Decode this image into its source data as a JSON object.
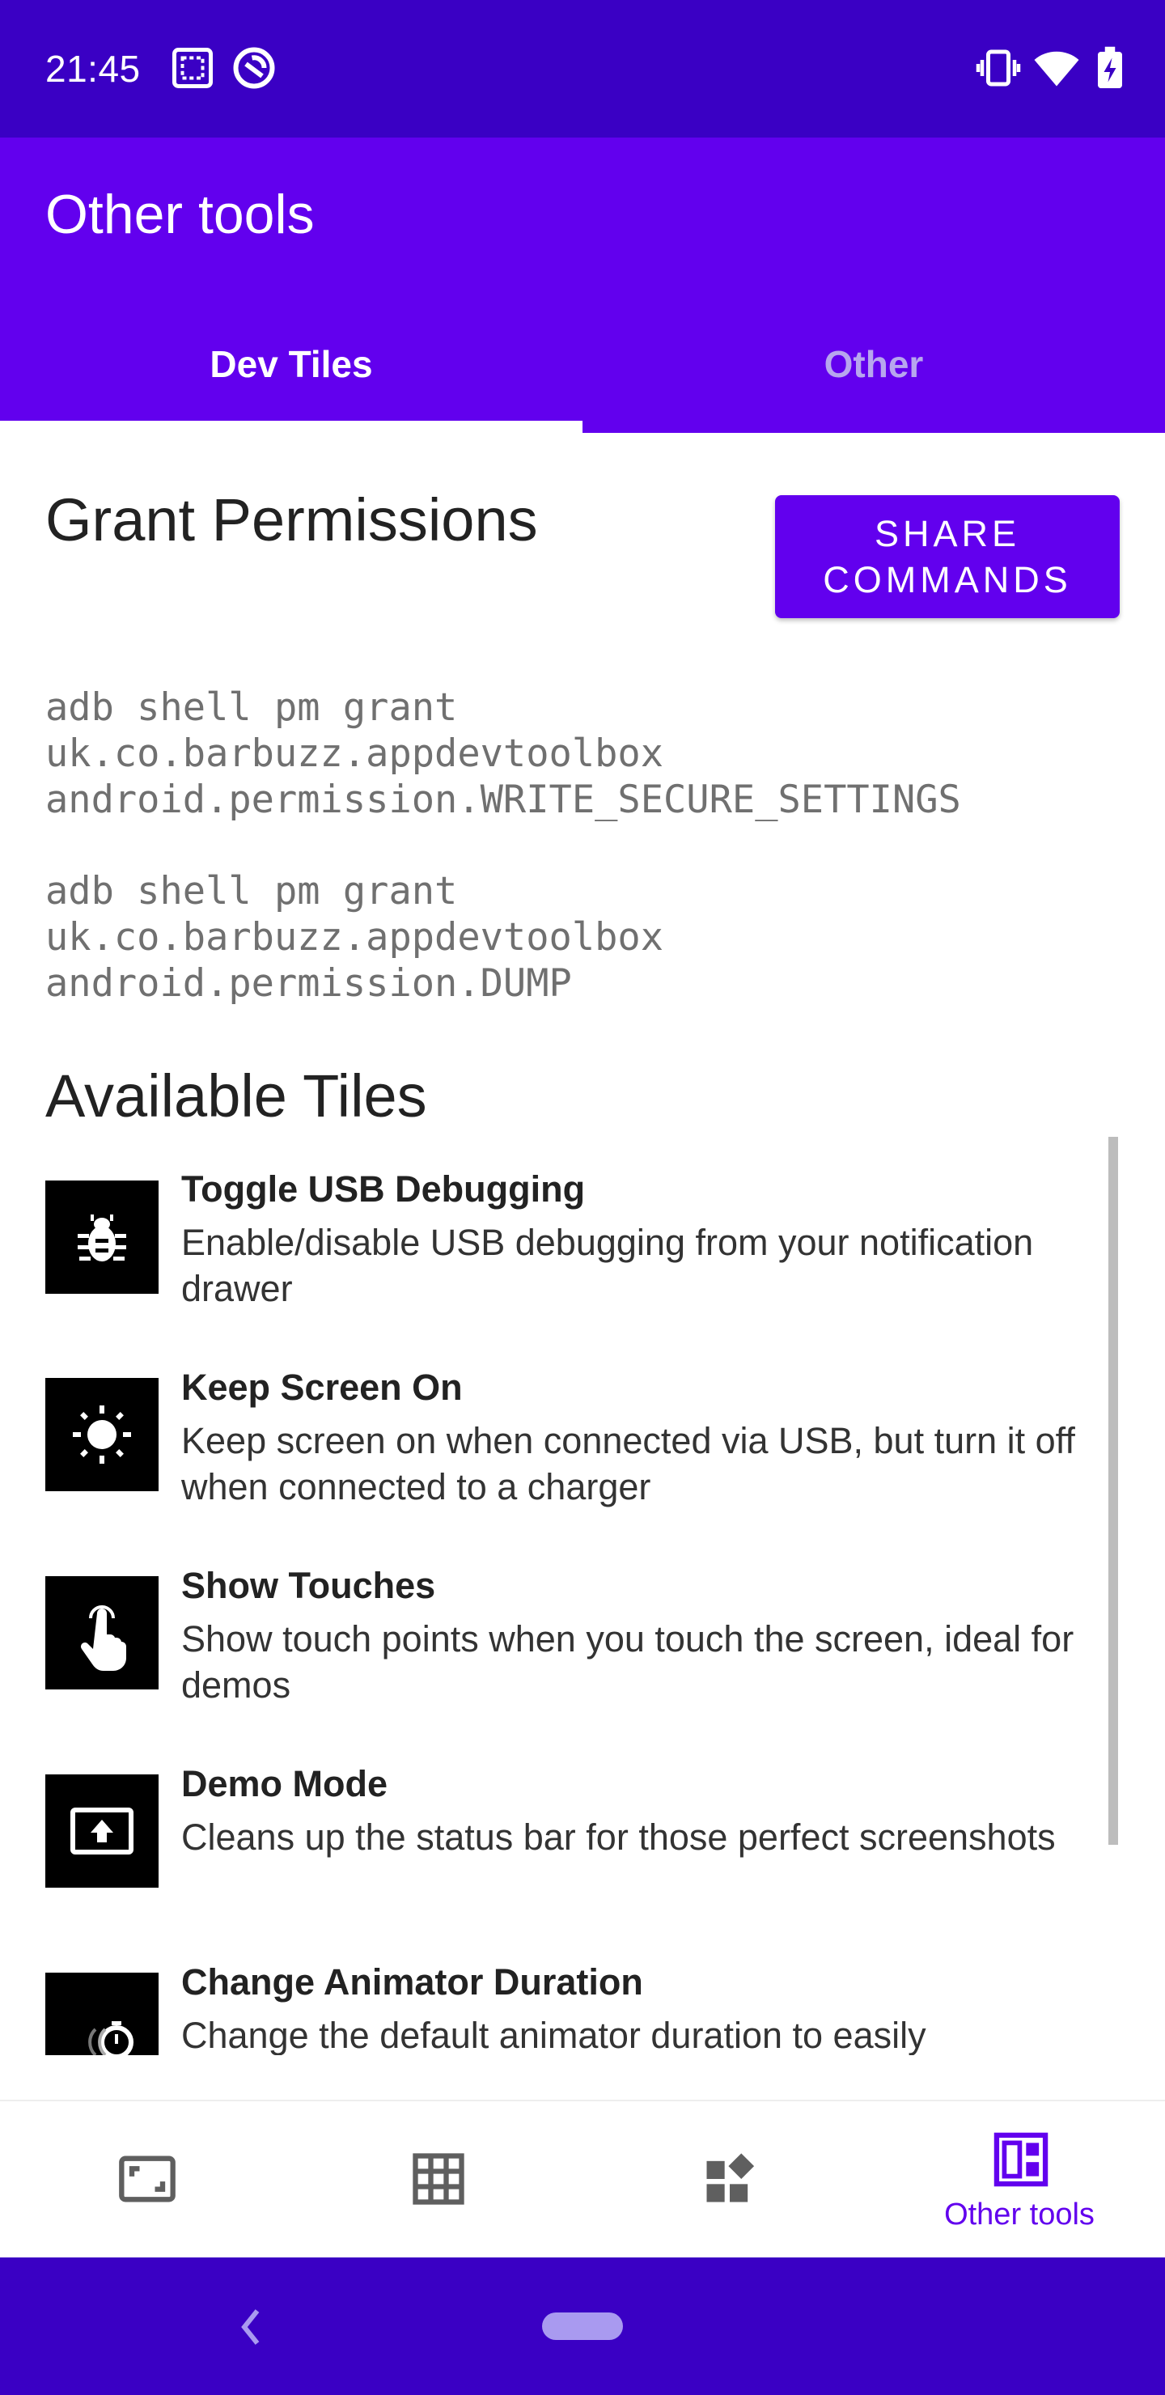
{
  "status_bar": {
    "time": "21:45",
    "icons": [
      "screenshot-icon",
      "data-saver-icon",
      "vibrate-icon",
      "wifi-icon",
      "battery-charging-icon"
    ]
  },
  "app_bar": {
    "title": "Other tools"
  },
  "tabs": [
    {
      "label": "Dev Tiles",
      "selected": true
    },
    {
      "label": "Other",
      "selected": false
    }
  ],
  "grant": {
    "title": "Grant Permissions",
    "share_label": "SHARE COMMANDS",
    "commands": [
      "adb shell pm grant\nuk.co.barbuzz.appdevtoolbox\nandroid.permission.WRITE_SECURE_SETTINGS",
      "adb shell pm grant\nuk.co.barbuzz.appdevtoolbox\nandroid.permission.DUMP"
    ]
  },
  "tiles": {
    "heading": "Available Tiles",
    "items": [
      {
        "title": "Toggle USB Debugging",
        "description": "Enable/disable USB debugging from your notification drawer",
        "icon": "bug-icon"
      },
      {
        "title": "Keep Screen On",
        "description": "Keep screen on when connected via USB, but turn it off when connected to a charger",
        "icon": "brightness-icon"
      },
      {
        "title": "Show Touches",
        "description": "Show touch points when you touch the screen, ideal for demos",
        "icon": "touch-icon"
      },
      {
        "title": "Demo Mode",
        "description": "Cleans up the status bar for those perfect screenshots",
        "icon": "demo-mode-icon"
      },
      {
        "title": "Change Animator Duration",
        "description": "Change the default animator duration to easily",
        "icon": "animator-duration-icon"
      }
    ]
  },
  "bottom_nav": {
    "items": [
      {
        "icon": "aspect-ratio-icon",
        "label": ""
      },
      {
        "icon": "grid-icon",
        "label": ""
      },
      {
        "icon": "widgets-icon",
        "label": ""
      },
      {
        "icon": "dashboard-icon",
        "label": "Other tools",
        "selected": true
      }
    ]
  },
  "colors": {
    "status_bar": "#3a00c4",
    "primary": "#6200ee",
    "inactive_tab": "#b7a6ee"
  }
}
